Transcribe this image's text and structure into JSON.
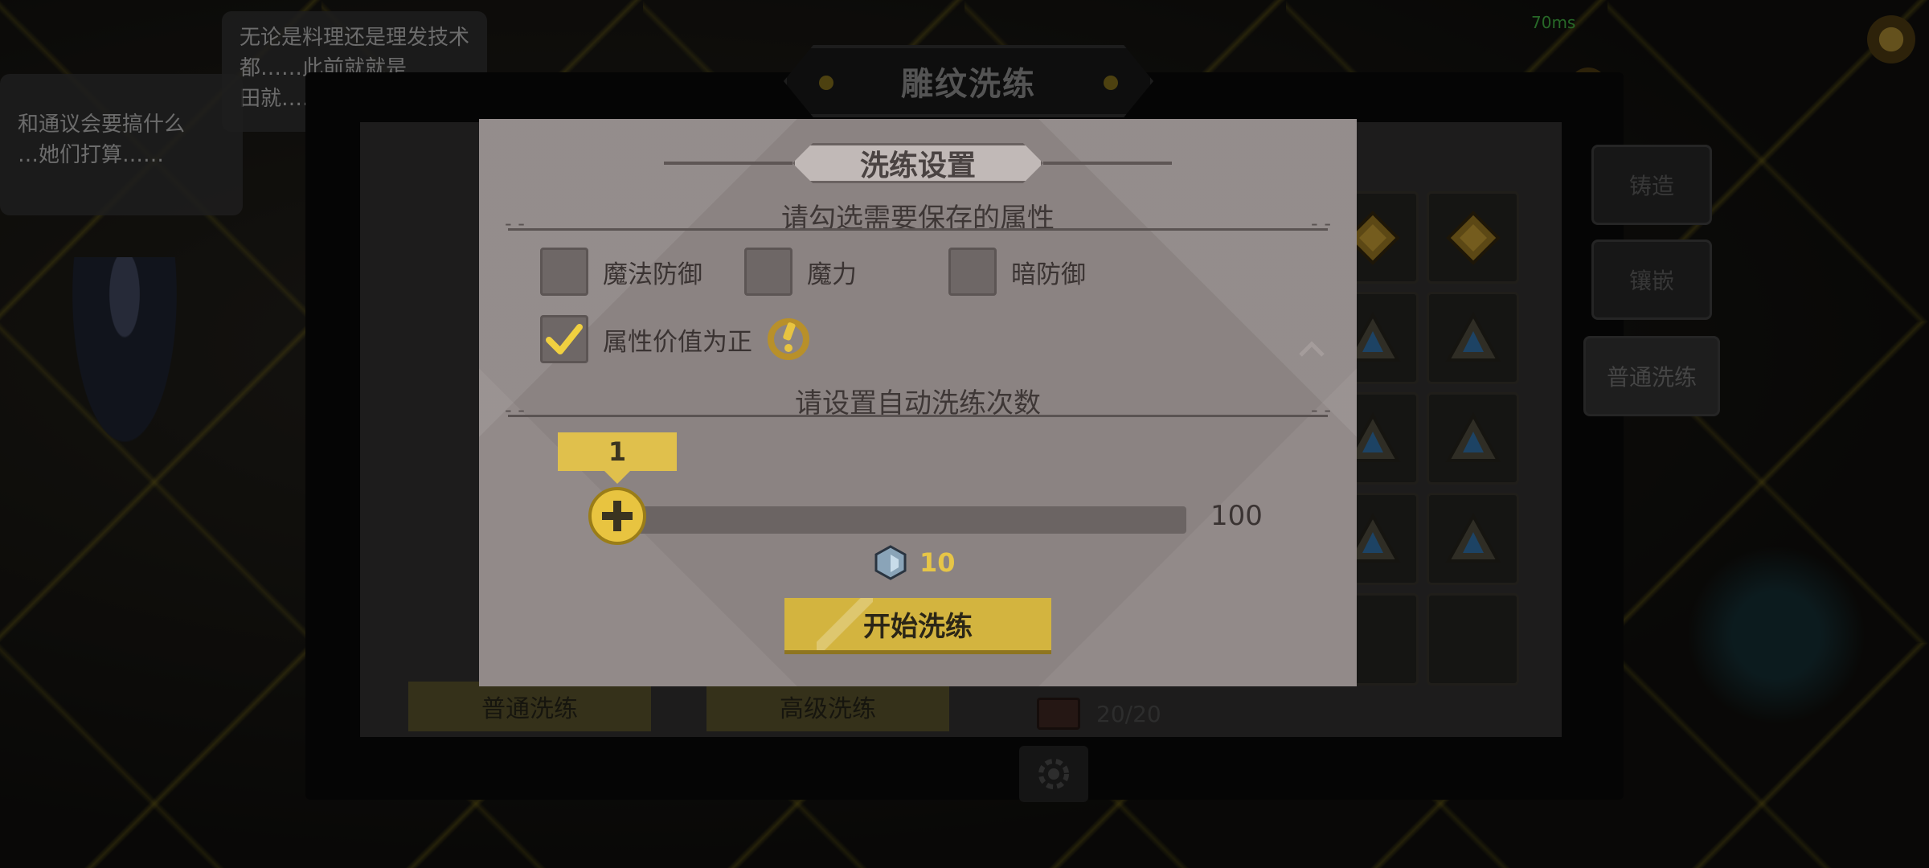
{
  "status": {
    "ping": "70ms"
  },
  "background": {
    "speech_bubble_1": "无论是料理还是理发技术",
    "speech_bubble_1_line2": "都……此前就就是",
    "speech_bubble_1_line3": "田就……",
    "speech_bubble_2": "和通议会要搞什么",
    "speech_bubble_2_line2": "…她们打算……"
  },
  "panel": {
    "title": "雕纹洗练",
    "side_tabs": [
      "铸造",
      "镶嵌",
      "普通洗练"
    ],
    "bottom_buttons": [
      "普通洗练",
      "高级洗练"
    ],
    "capacity": "20/20"
  },
  "modal": {
    "title": "洗练设置",
    "attributes_prompt": "请勾选需要保存的属性",
    "attributes": [
      {
        "label": "魔法防御",
        "checked": false
      },
      {
        "label": "魔力",
        "checked": false
      },
      {
        "label": "暗防御",
        "checked": false
      }
    ],
    "positive_only": {
      "label": "属性价值为正",
      "checked": true
    },
    "count_prompt": "请设置自动洗练次数",
    "slider": {
      "value": "1",
      "min": "1",
      "max": "100",
      "current": 1,
      "min_value": 1,
      "max_value": 100
    },
    "cost": {
      "amount": "10",
      "icon": "refine-stone-icon"
    },
    "start_button": "开始洗练"
  },
  "colors": {
    "accent_gold": "#d3b43f",
    "modal_bg": "#8b8382",
    "ping_green": "#4ed04e"
  }
}
